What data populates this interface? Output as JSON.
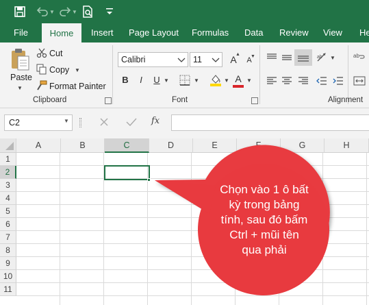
{
  "quick_access": {
    "icons": [
      "save-icon",
      "undo-icon",
      "redo-icon",
      "print-preview-icon",
      "customize-qat-icon"
    ]
  },
  "tabs": [
    "File",
    "Home",
    "Insert",
    "Page Layout",
    "Formulas",
    "Data",
    "Review",
    "View",
    "He"
  ],
  "active_tab": "Home",
  "clipboard": {
    "paste": "Paste",
    "cut": "Cut",
    "copy": "Copy",
    "format_painter": "Format Painter",
    "label": "Clipboard"
  },
  "font": {
    "name": "Calibri",
    "size": "11",
    "grow": "A",
    "shrink": "A",
    "bold": "B",
    "italic": "I",
    "underline": "U",
    "color_letter": "A",
    "label": "Font"
  },
  "alignment": {
    "label": "Alignment"
  },
  "formula_bar": {
    "name_box": "C2",
    "fx": "fx",
    "formula": ""
  },
  "columns": [
    "A",
    "B",
    "C",
    "D",
    "E",
    "F",
    "G",
    "H"
  ],
  "rows": [
    "1",
    "2",
    "3",
    "4",
    "5",
    "6",
    "7",
    "8",
    "9",
    "10",
    "11"
  ],
  "selected_cell": "C2",
  "callout": {
    "text": "Chọn vào 1 ô bất kỳ trong bảng tính, sau đó bấm Ctrl + mũi tên qua phải",
    "lines": [
      "Chọn vào 1 ô bất",
      "kỳ trong bảng",
      "tính, sau đó bấm",
      "Ctrl + mũi tên",
      "qua phải"
    ]
  },
  "colors": {
    "brand": "#217346",
    "callout": "#e83a3f",
    "fill_highlight": "#ffd800",
    "font_color": "#d9262b"
  }
}
